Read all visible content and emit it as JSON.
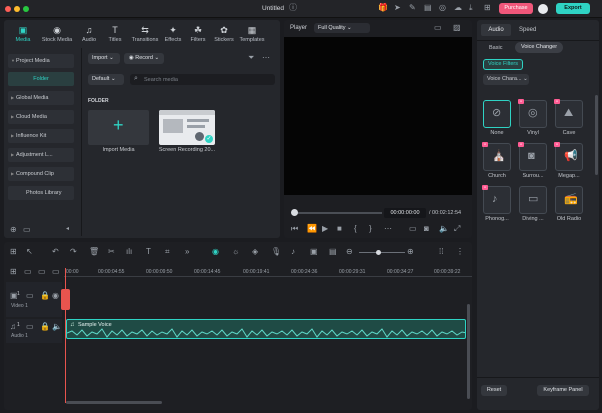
{
  "titlebar": {
    "title": "Untitled",
    "purchase_label": "Purchase",
    "export_label": "Export",
    "colors": {
      "purchase": "#f0577a",
      "export": "#2fd3c4"
    }
  },
  "toolbar": {
    "items": [
      {
        "label": "Media",
        "icon": "media-icon"
      },
      {
        "label": "Stock Media",
        "icon": "stock-icon"
      },
      {
        "label": "Audio",
        "icon": "music-icon"
      },
      {
        "label": "Titles",
        "icon": "titles-icon"
      },
      {
        "label": "Transitions",
        "icon": "transitions-icon"
      },
      {
        "label": "Effects",
        "icon": "effects-icon"
      },
      {
        "label": "Filters",
        "icon": "filters-icon"
      },
      {
        "label": "Stickers",
        "icon": "stickers-icon"
      },
      {
        "label": "Templates",
        "icon": "templates-icon"
      }
    ]
  },
  "sidebar": {
    "items": [
      "Project Media",
      "Folder",
      "Global Media",
      "Cloud Media",
      "Influence Kit",
      "Adjustment L...",
      "Compound Clip",
      "Photos Library"
    ]
  },
  "media": {
    "import_label": "Import",
    "record_label": "Record",
    "default_label": "Default",
    "search_placeholder": "Search media",
    "folder_heading": "FOLDER",
    "tiles": [
      {
        "label": "Import Media"
      },
      {
        "label": "Screen Recording 20..."
      }
    ]
  },
  "player": {
    "label": "Player",
    "quality": "Full Quality",
    "current_time": "00:00:00:00",
    "total_time": "/ 00:02:12:54"
  },
  "right": {
    "tabs": [
      "Audio",
      "Speed"
    ],
    "subtabs": [
      "Basic",
      "Voice Changer"
    ],
    "voice_filters_label": "Voice Filters",
    "voice_chars_label": "Voice Chara...",
    "effects": [
      {
        "label": "None",
        "icon": "none-icon",
        "premium": false
      },
      {
        "label": "Vinyl",
        "icon": "vinyl-icon",
        "premium": true
      },
      {
        "label": "Cave",
        "icon": "cave-icon",
        "premium": true
      },
      {
        "label": "Church",
        "icon": "church-icon",
        "premium": true
      },
      {
        "label": "Surrou...",
        "icon": "surround-icon",
        "premium": true
      },
      {
        "label": "Megap...",
        "icon": "megaphone-icon",
        "premium": true
      },
      {
        "label": "Phonog...",
        "icon": "phonograph-icon",
        "premium": true
      },
      {
        "label": "Diving ...",
        "icon": "diving-icon",
        "premium": false
      },
      {
        "label": "Old Radio",
        "icon": "radio-icon",
        "premium": false
      }
    ],
    "reset_label": "Reset",
    "keyframe_label": "Keyframe Panel"
  },
  "timeline": {
    "ticks": [
      "00:00",
      "00:00:04:55",
      "00:00:09:50",
      "00:00:14:45",
      "00:00:19:41",
      "00:00:24:36",
      "00:00:29:31",
      "00:00:34:27",
      "00:00:39:22"
    ],
    "tracks": [
      {
        "badge": "1",
        "name": "Video 1"
      },
      {
        "badge": "1",
        "name": "Audio 1"
      }
    ],
    "clip_label": "Sample Voice"
  }
}
